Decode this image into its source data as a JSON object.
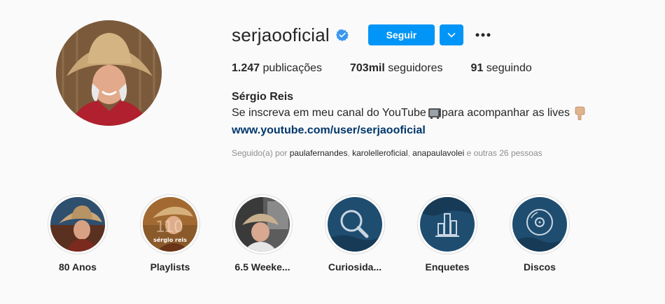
{
  "profile": {
    "username": "serjaooficial",
    "verified": true,
    "follow_label": "Seguir",
    "full_name": "Sérgio Reis",
    "bio_part1": "Se inscreva em meu canal do YouTube ",
    "bio_part2": "para acompanhar as lives",
    "bio_icons": [
      "television-emoji",
      "pointing-down-emoji"
    ],
    "link": "www.youtube.com/user/serjaooficial"
  },
  "stats": {
    "posts_count": "1.247",
    "posts_label": "publicações",
    "followers_count": "703mil",
    "followers_label": "seguidores",
    "following_count": "91",
    "following_label": "seguindo"
  },
  "followed_by": {
    "prefix": "Seguido(a) por ",
    "users": [
      "paulafernandes",
      "karolelleroficial",
      "anapaulavolei"
    ],
    "separator": ", ",
    "suffix": " e outras 26 pessoas"
  },
  "highlights": [
    {
      "label": "80 Anos",
      "icon": "photo-thumbnail"
    },
    {
      "label": "Playlists",
      "icon": "photo-thumbnail",
      "overlay_text": "sérgio reis"
    },
    {
      "label": "6.5 Weeke...",
      "icon": "photo-thumbnail"
    },
    {
      "label": "Curiosida...",
      "icon": "magnifier-icon"
    },
    {
      "label": "Enquetes",
      "icon": "bar-chart-icon"
    },
    {
      "label": "Discos",
      "icon": "disc-icon"
    }
  ],
  "colors": {
    "accent": "#0095f6",
    "link": "#00376b",
    "highlight_bg": "#1f4d70",
    "verified": "#3897f0"
  }
}
